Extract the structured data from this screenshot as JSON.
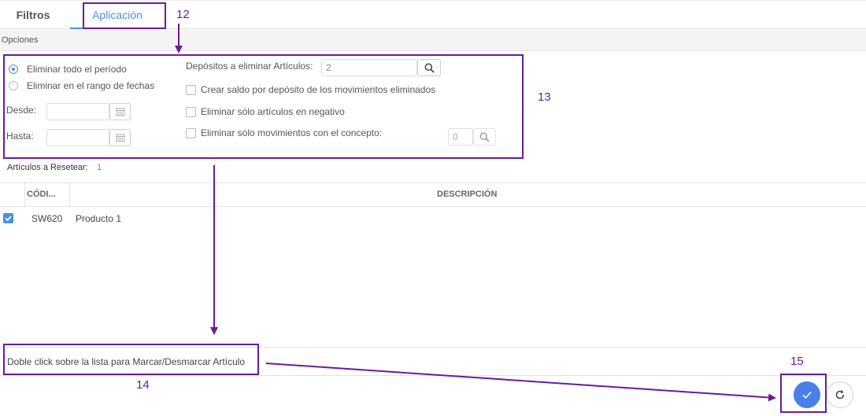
{
  "tabs": [
    {
      "label": "Filtros"
    },
    {
      "label": "Aplicación"
    }
  ],
  "section": {
    "title": "Opciones"
  },
  "options": {
    "radio_all": "Eliminar todo el período",
    "radio_range": "Eliminar en el rango de fechas",
    "desde_label": "Desde:",
    "hasta_label": "Hasta:",
    "depositos_label": "Depósitos a eliminar Artículos:",
    "depositos_value": "2",
    "crear_saldo_label": "Crear saldo por depósito de los movimientos eliminados",
    "negativo_label": "Eliminar sólo artículos en negativo",
    "concepto_label": "Eliminar sólo movimientos con el concepto:",
    "concepto_value": "0"
  },
  "reset": {
    "label": "Artículos a Resetear:",
    "count": "1"
  },
  "table": {
    "columns": [
      "CÓDI...",
      "DESCRIPCIÓN"
    ],
    "rows": [
      {
        "code": "SW620",
        "description": "Producto 1",
        "checked": true
      }
    ]
  },
  "hint": "Doble click sobre la lista para Marcar/Desmarcar Artículo",
  "annotations": [
    "12",
    "13",
    "14",
    "15"
  ],
  "colors": {
    "accent": "#4a90e2",
    "annotation": "#6a1b9a"
  },
  "icons": [
    "search-icon",
    "calendar-icon",
    "check-icon",
    "refresh-icon"
  ]
}
